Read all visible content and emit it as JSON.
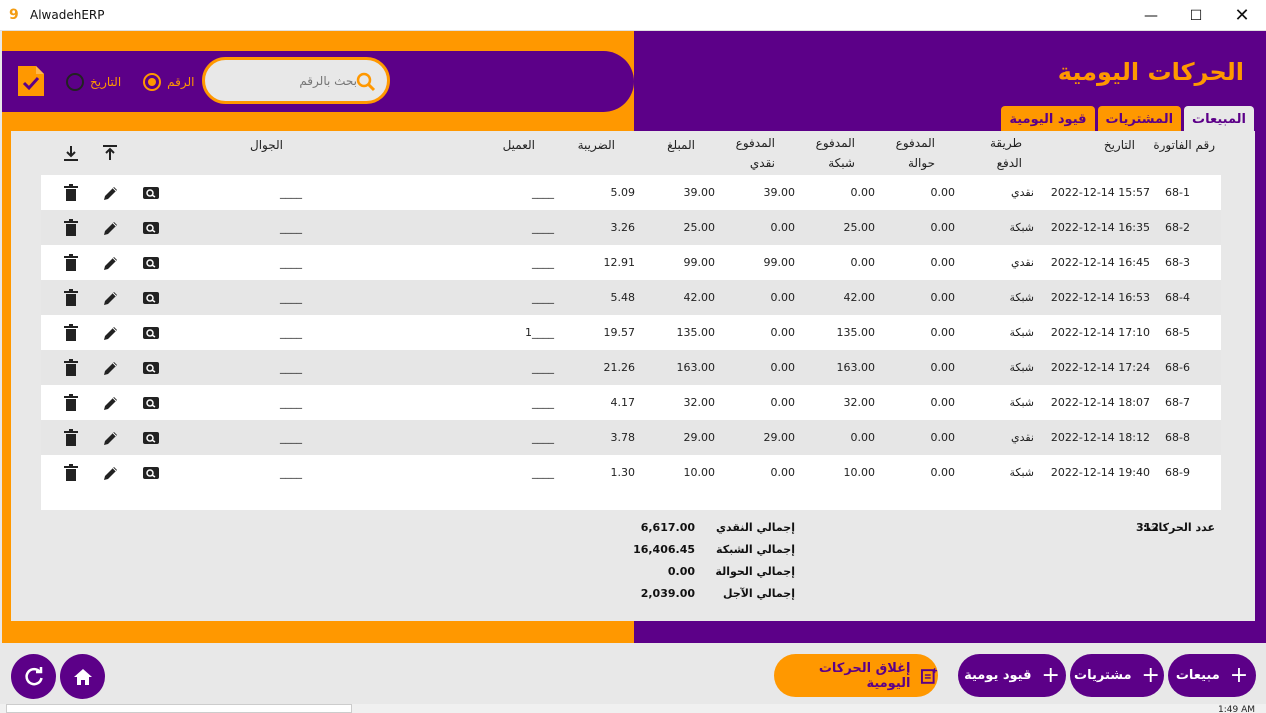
{
  "window": {
    "logo": "9",
    "title": "AlwadehERP",
    "minimize": "—",
    "maximize": "☐",
    "close": "✕"
  },
  "header": {
    "title": "الحركات اليومية",
    "search_placeholder": "بحث بالرقم",
    "radio_number": "الرقم",
    "radio_date": "التاريخ",
    "selected_radio": "number"
  },
  "tabs": [
    {
      "label": "المبيعات",
      "active": true
    },
    {
      "label": "المشتريات",
      "active": false
    },
    {
      "label": "قيود اليومية",
      "active": false
    }
  ],
  "table": {
    "headers": {
      "invoice": "رقم الفاتورة",
      "date": "التاريخ",
      "payment_method": "طريقة\nالدفع",
      "paid_transfer": "المدفوع\nحوالة",
      "paid_network": "المدفوع\nشبكة",
      "paid_cash": "المدفوع\nنقدي",
      "amount": "المبلغ",
      "tax": "الضريبة",
      "customer": "العميل",
      "mobile": "الجوال"
    },
    "rows": [
      {
        "invoice": "68-1",
        "date": "2022-12-14 15:57",
        "method": "نقدي",
        "transfer": "0.00",
        "network": "0.00",
        "cash": "39.00",
        "amount": "39.00",
        "tax": "5.09",
        "customer": "____",
        "mobile": "____"
      },
      {
        "invoice": "68-2",
        "date": "2022-12-14 16:35",
        "method": "شبكة",
        "transfer": "0.00",
        "network": "25.00",
        "cash": "0.00",
        "amount": "25.00",
        "tax": "3.26",
        "customer": "____",
        "mobile": "____"
      },
      {
        "invoice": "68-3",
        "date": "2022-12-14 16:45",
        "method": "نقدي",
        "transfer": "0.00",
        "network": "0.00",
        "cash": "99.00",
        "amount": "99.00",
        "tax": "12.91",
        "customer": "____",
        "mobile": "____"
      },
      {
        "invoice": "68-4",
        "date": "2022-12-14 16:53",
        "method": "شبكة",
        "transfer": "0.00",
        "network": "42.00",
        "cash": "0.00",
        "amount": "42.00",
        "tax": "5.48",
        "customer": "____",
        "mobile": "____"
      },
      {
        "invoice": "68-5",
        "date": "2022-12-14 17:10",
        "method": "شبكة",
        "transfer": "0.00",
        "network": "135.00",
        "cash": "0.00",
        "amount": "135.00",
        "tax": "19.57",
        "customer": "1____",
        "mobile": "____"
      },
      {
        "invoice": "68-6",
        "date": "2022-12-14 17:24",
        "method": "شبكة",
        "transfer": "0.00",
        "network": "163.00",
        "cash": "0.00",
        "amount": "163.00",
        "tax": "21.26",
        "customer": "____",
        "mobile": "____"
      },
      {
        "invoice": "68-7",
        "date": "2022-12-14 18:07",
        "method": "شبكة",
        "transfer": "0.00",
        "network": "32.00",
        "cash": "0.00",
        "amount": "32.00",
        "tax": "4.17",
        "customer": "____",
        "mobile": "____"
      },
      {
        "invoice": "68-8",
        "date": "2022-12-14 18:12",
        "method": "نقدي",
        "transfer": "0.00",
        "network": "0.00",
        "cash": "29.00",
        "amount": "29.00",
        "tax": "3.78",
        "customer": "____",
        "mobile": "____"
      },
      {
        "invoice": "68-9",
        "date": "2022-12-14 19:40",
        "method": "شبكة",
        "transfer": "0.00",
        "network": "10.00",
        "cash": "0.00",
        "amount": "10.00",
        "tax": "1.30",
        "customer": "____",
        "mobile": "____"
      }
    ]
  },
  "totals": {
    "count_label": "عدد الحركات:",
    "count_value": "312",
    "cash_label": "إجمالي النقدي",
    "cash_value": "6,617.00",
    "network_label": "إجمالي الشبكة",
    "network_value": "16,406.45",
    "transfer_label": "إجمالي الحوالة",
    "transfer_value": "0.00",
    "credit_label": "إجمالي الآجل",
    "credit_value": "2,039.00"
  },
  "bottom": {
    "sales_label": "مبيعات",
    "purchases_label": "مشتريات",
    "journal_label": "قيود يومية",
    "close_day_label": "إغلاق الحركات اليومية",
    "plus": "+"
  },
  "taskbar": {
    "time": "1:49 AM"
  },
  "colors": {
    "purple": "#5c0088",
    "orange": "#ff9800",
    "panel": "#e8e8e8"
  }
}
